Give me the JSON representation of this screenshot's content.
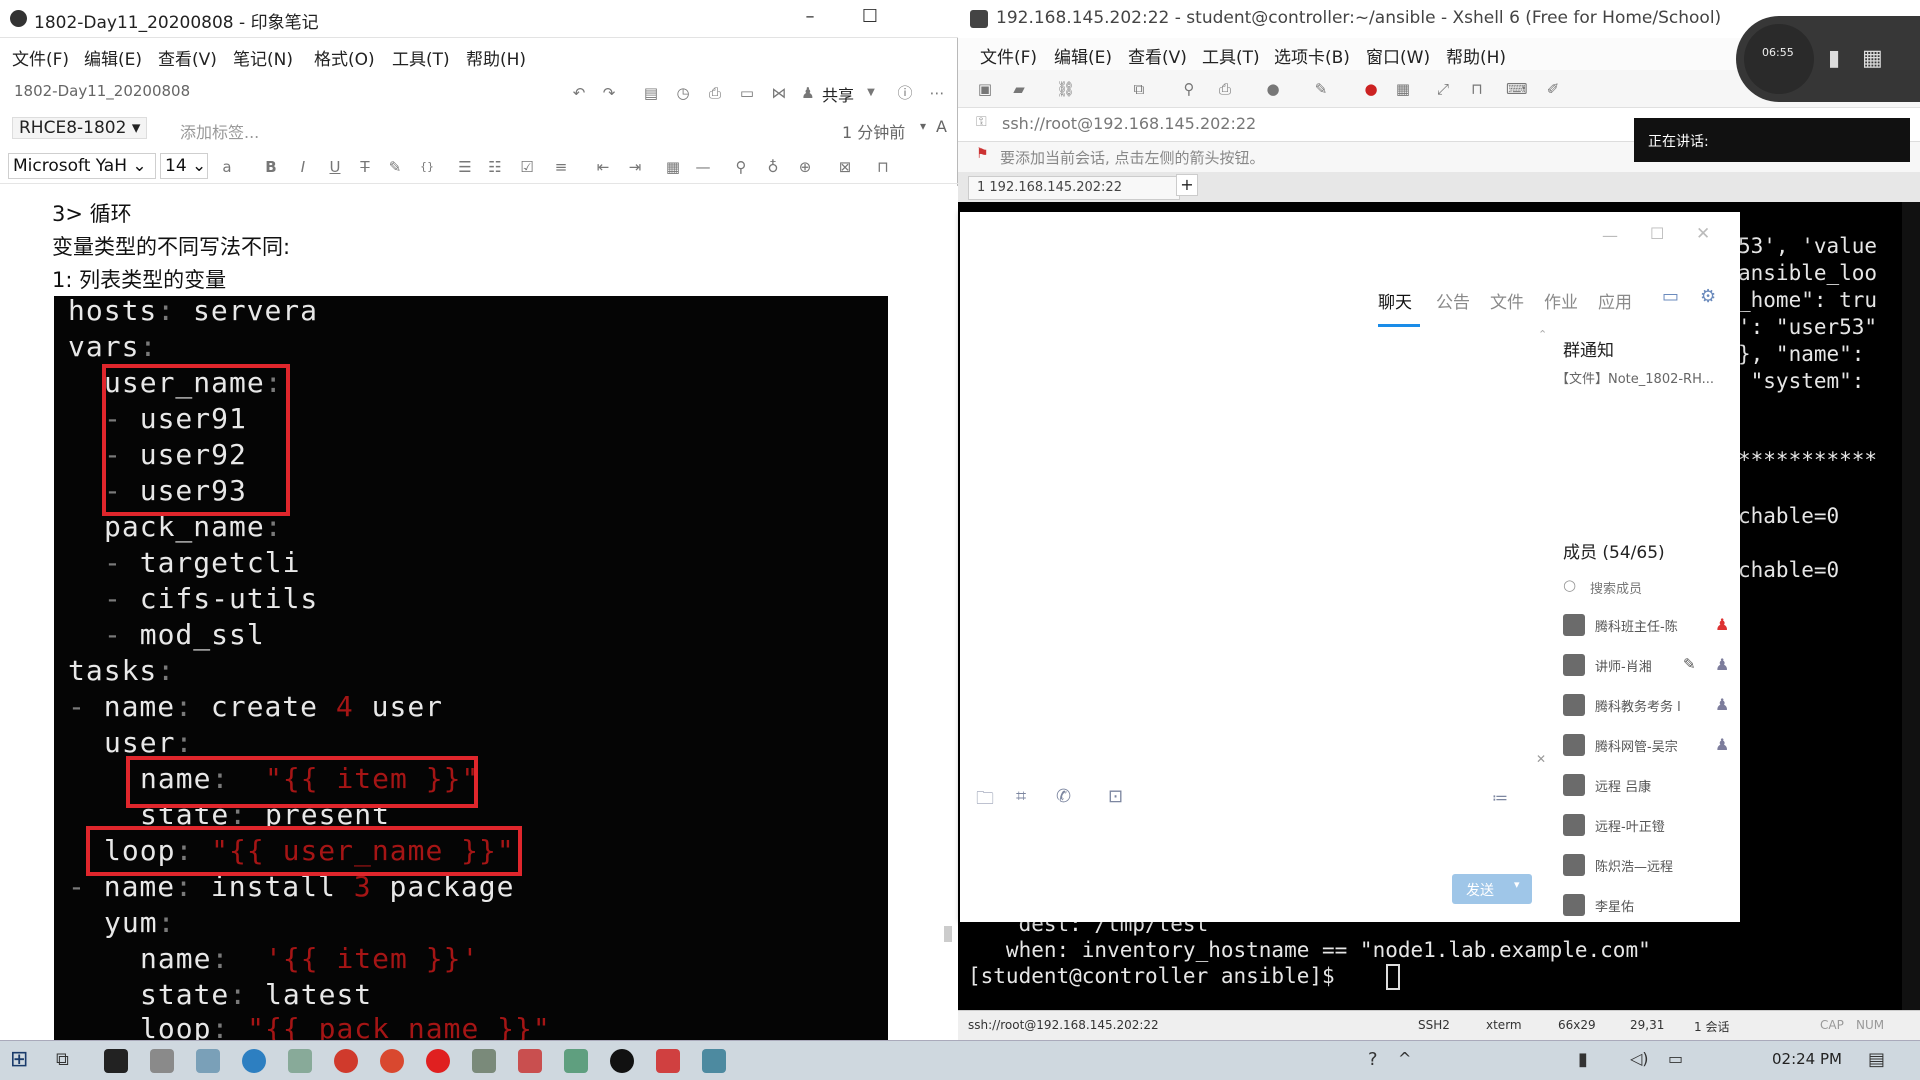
{
  "evernote": {
    "window_title": "1802-Day11_20200808 - 印象笔记",
    "menu": [
      "文件(F)",
      "编辑(E)",
      "查看(V)",
      "笔记(N)",
      "格式(O)",
      "工具(T)",
      "帮助(H)"
    ],
    "note_name": "1802-Day11_20200808",
    "share_label": "共享",
    "notebook": "RHCE8-1802",
    "add_tag": "添加标签...",
    "time_ago": "1 分钟前",
    "font": "Microsoft YaH",
    "font_size": "14",
    "lines": [
      "3> 循环",
      "变量类型的不同写法不同:",
      "1: 列表类型的变量"
    ],
    "code": {
      "hosts": "hosts",
      "hosts_val": "servera",
      "vars": "vars",
      "user_name": "user_name",
      "users": [
        "user91",
        "user92",
        "user93"
      ],
      "pack_name": "pack_name",
      "packs": [
        "targetcli",
        "cifs-utils",
        "mod_ssl"
      ],
      "tasks": "tasks",
      "task1_name": "create",
      "task1_num": "4",
      "task1_rest": "user",
      "user_mod": "user",
      "name_key": "name",
      "item_val": "\"{{ item }}\"",
      "state_key": "state",
      "state_present": "present",
      "loop_key": "loop",
      "loop_user": "\"{{ user_name }}\"",
      "task2_name": "install",
      "task2_num": "3",
      "task2_rest": "package",
      "yum_mod": "yum",
      "yum_item": "'{{ item }}'",
      "state_latest": "latest",
      "loop_pack": "\"{{ pack_name }}\""
    }
  },
  "xshell": {
    "window_title": "192.168.145.202:22 - student@controller:~/ansible - Xshell 6 (Free for Home/School)",
    "menu": [
      "文件(F)",
      "编辑(E)",
      "查看(V)",
      "工具(T)",
      "选项卡(B)",
      "窗口(W)",
      "帮助(H)"
    ],
    "address": "ssh://root@192.168.145.202:22",
    "hint": "要添加当前会话, 点击左侧的箭头按钮。",
    "tab_label": "1 192.168.145.202:22",
    "term_right": [
      "53', 'value",
      "ansible_loo",
      "_home\": tru",
      "': \"user53\"",
      "}, \"name\":",
      " \"system\":",
      "***********",
      "chable=0",
      "chable=0"
    ],
    "term_bottom": [
      "    dest: /tmp/test",
      "   when: inventory_hostname == \"node1.lab.example.com\"",
      "[student@controller ansible]$ "
    ],
    "status": {
      "conn": "ssh://root@192.168.145.202:22",
      "proto": "SSH2",
      "term": "xterm",
      "size": "66x29",
      "pos": "29,31",
      "sessions": "1 会话",
      "cap": "CAP",
      "num": "NUM"
    }
  },
  "qq": {
    "tabs": [
      "聊天",
      "公告",
      "文件",
      "作业",
      "应用"
    ],
    "notice_title": "群通知",
    "notice_file": "【文件】Note_1802-RH...",
    "members_title": "成员 (54/65)",
    "search_members": "搜索成员",
    "members": [
      "腾科班主任-陈",
      "讲师-肖湘",
      "腾科教务考务 l",
      "腾科网管-吴宗",
      "远程 吕康",
      "远程-叶正镫",
      "陈炽浩—远程",
      "李星佑"
    ],
    "send_label": "发送"
  },
  "overlay": {
    "speaking_label": "正在讲话:",
    "clock_small": "06:55"
  },
  "taskbar": {
    "time": "02:24 PM"
  }
}
